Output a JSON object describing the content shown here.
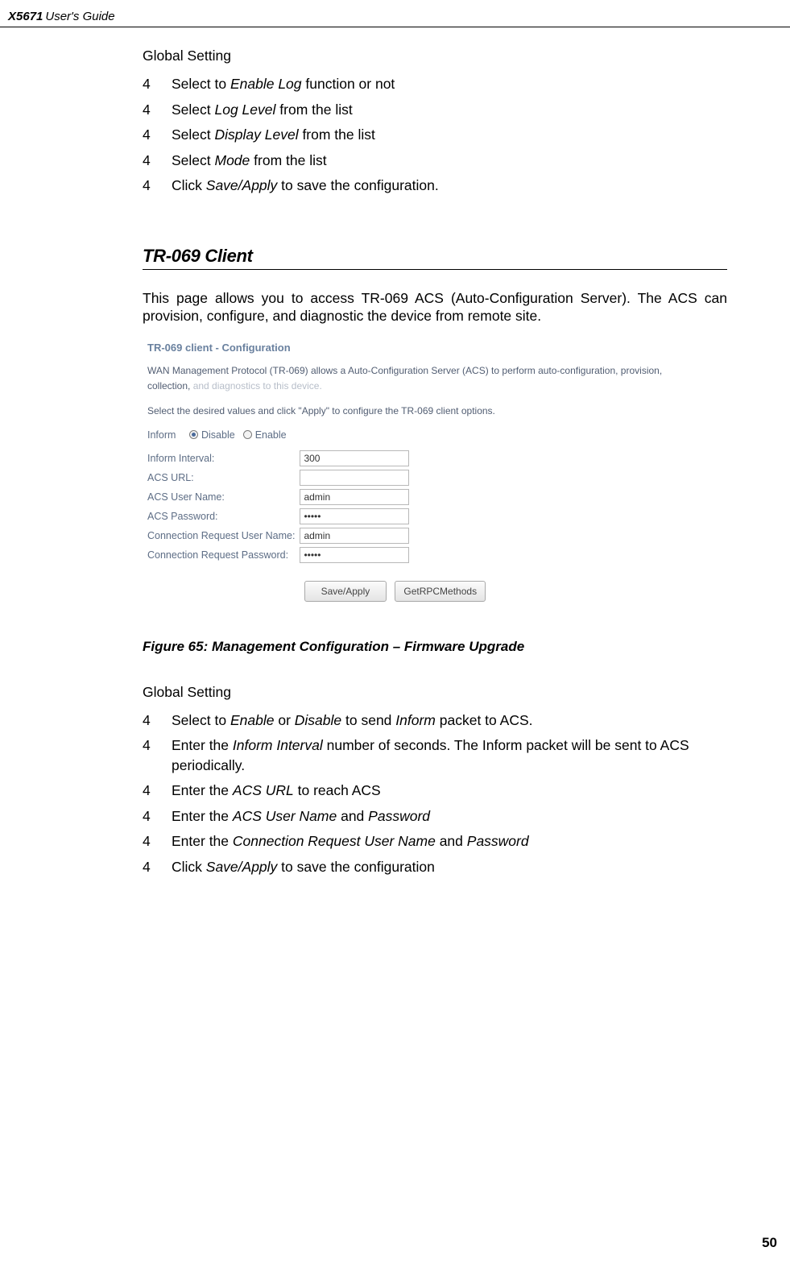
{
  "header": {
    "product": "X5671",
    "suffix": " User's Guide"
  },
  "top": {
    "label": "Global Setting",
    "items": [
      {
        "marker": "4",
        "pre": "Select to ",
        "it1": "Enable Log",
        "mid": " function or not"
      },
      {
        "marker": "4",
        "pre": "Select ",
        "it1": "Log Level",
        "mid": " from the list"
      },
      {
        "marker": "4",
        "pre": "Select ",
        "it1": "Display Level",
        "mid": " from the list"
      },
      {
        "marker": "4",
        "pre": "Select ",
        "it1": "Mode",
        "mid": " from the list"
      },
      {
        "marker": "4",
        "pre": "Click ",
        "it1": "Save/Apply",
        "mid": " to save the configuration."
      }
    ]
  },
  "section": {
    "heading": "TR-069 Client",
    "para": "This page allows you to access TR-069 ACS (Auto-Configuration Server). The ACS can provision, configure, and diagnostic the device from remote site."
  },
  "shot": {
    "title": "TR-069 client - Configuration",
    "p1a": "WAN Management Protocol (TR-069) allows a Auto-Configuration Server (ACS) to perform auto-configuration, provision, collection, ",
    "p1b": "and diagnostics to this device.",
    "p2": "Select the desired values and click \"Apply\" to configure the TR-069 client options.",
    "inform_label": "Inform",
    "disable": "Disable",
    "enable": "Enable",
    "rows": {
      "r1": "Inform Interval:",
      "r2": "ACS URL:",
      "r3": "ACS User Name:",
      "r4": "ACS Password:",
      "r5": "Connection Request User Name:",
      "r6": "Connection Request Password:"
    },
    "vals": {
      "interval": "300",
      "url": "",
      "user": "admin",
      "pass": "•••••",
      "cr_user": "admin",
      "cr_pass": "•••••"
    },
    "btn_save": "Save/Apply",
    "btn_rpc": "GetRPCMethods"
  },
  "caption": "Figure 65: Management Configuration – Firmware Upgrade",
  "bottom": {
    "label": "Global Setting",
    "items": [
      {
        "marker": "4",
        "pre": "Select to ",
        "it1": "Enable",
        "mid": " or ",
        "it2": "Disable",
        "post": " to send ",
        "it3": "Inform",
        "tail": " packet to ACS."
      },
      {
        "marker": "4",
        "pre": "Enter the ",
        "it1": "Inform Interval",
        "mid": " number of seconds. The Inform packet will be sent to ACS periodically."
      },
      {
        "marker": "4",
        "pre": "Enter the ",
        "it1": "ACS URL",
        "mid": " to reach ACS"
      },
      {
        "marker": "4",
        "pre": "Enter the ",
        "it1": "ACS User Name",
        "mid": " and ",
        "it2": "Password"
      },
      {
        "marker": "4",
        "pre": "Enter the ",
        "it1": "Connection Request User Name",
        "mid": " and ",
        "it2": "Password"
      },
      {
        "marker": "4",
        "pre": "Click ",
        "it1": "Save/Apply",
        "mid": " to save the configuration"
      }
    ]
  },
  "page_number": "50"
}
